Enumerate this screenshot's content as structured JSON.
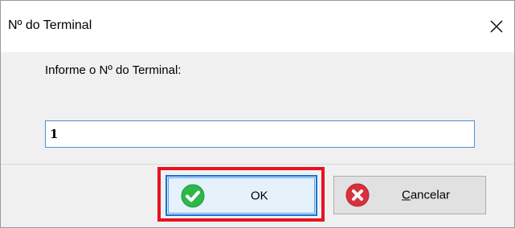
{
  "window": {
    "title": "Nº do Terminal",
    "close_glyph": "✕"
  },
  "form": {
    "prompt": "Informe o Nº do Terminal:",
    "terminal_value": "1"
  },
  "buttons": {
    "ok_label": "OK",
    "ok_icon": "check-circle-icon",
    "cancel_label": "Cancelar",
    "cancel_icon": "x-circle-icon"
  },
  "colors": {
    "ok_icon_green": "#2db84a",
    "cancel_icon_red": "#d9303b",
    "highlight_red": "#e8121f",
    "focus_blue": "#0f73d9"
  }
}
